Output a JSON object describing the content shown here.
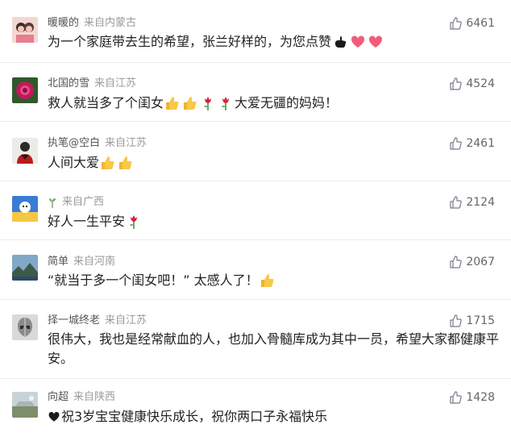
{
  "comments": [
    {
      "username": "暖暖的",
      "location": "来自内蒙古",
      "likes": "6461",
      "text": "为一个家庭带去生的希望，张兰好样的，为您点赞",
      "emojis": [
        "pointing-hand-icon",
        "heart-icon",
        "heart-icon"
      ]
    },
    {
      "username": "北国的雪",
      "location": "来自江苏",
      "likes": "4524",
      "text_a": "救人就当多了个闺女",
      "emojis": [
        "thumbs-up-icon",
        "thumbs-up-icon",
        "rose-icon",
        "rose-icon"
      ],
      "text_b": "大爱无疆的妈妈！"
    },
    {
      "username": "执笔@空白",
      "location": "来自江苏",
      "likes": "2461",
      "text": "人间大爱",
      "emojis": [
        "thumbs-up-icon",
        "thumbs-up-icon"
      ]
    },
    {
      "username": "",
      "location": "来自广西",
      "likes": "2124",
      "text": "好人一生平安",
      "emojis": [
        "rose-icon"
      ]
    },
    {
      "username": "简单",
      "location": "来自河南",
      "likes": "2067",
      "text": "“就当于多一个闺女吧！” 太感人了！",
      "emojis": [
        "thumbs-up-icon"
      ]
    },
    {
      "username": "择一城终老",
      "location": "来自江苏",
      "likes": "1715",
      "text": "很伟大，我也是经常献血的人，也加入骨髓库成为其中一员，希望大家都健康平安。"
    },
    {
      "username": "向超",
      "location": "来自陕西",
      "likes": "1428",
      "emojis": [
        "black-heart-icon"
      ],
      "text": "祝3岁宝宝健康快乐成长，祝你两口子永福快乐"
    }
  ],
  "colors": {
    "username": "#555555",
    "location": "#9a9a9a",
    "text": "#222222",
    "like": "#666666",
    "divider": "#ececec"
  }
}
